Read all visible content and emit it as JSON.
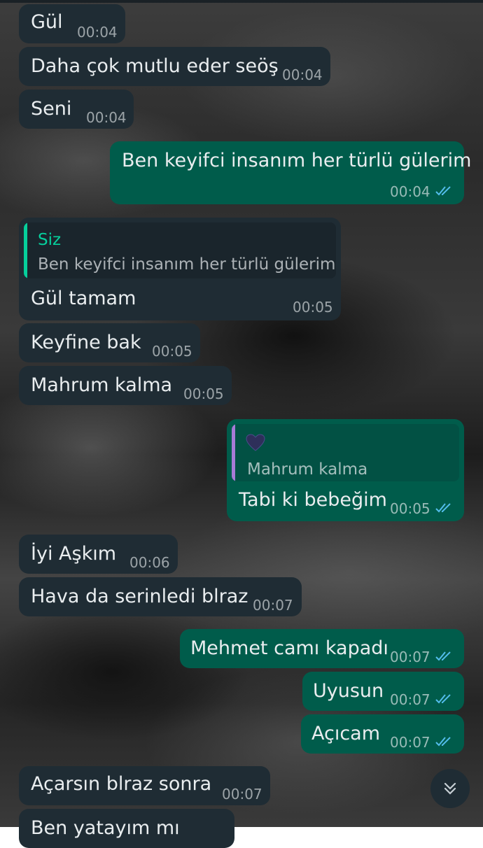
{
  "messages": [
    {
      "id": "m1",
      "dir": "in",
      "text": "Gül",
      "time": "00:04"
    },
    {
      "id": "m2",
      "dir": "in",
      "text": "Daha çok mutlu eder seöş",
      "time": "00:04"
    },
    {
      "id": "m3",
      "dir": "in",
      "text": "Seni",
      "time": "00:04"
    },
    {
      "id": "m4",
      "dir": "out",
      "text": "Ben keyifci insanım her türlü gülerim",
      "time": "00:04",
      "read": true
    },
    {
      "id": "m5",
      "dir": "in",
      "text": "Gül tamam",
      "time": "00:05",
      "quote": {
        "author": "Siz",
        "text": "Ben keyifci insanım her türlü gülerim"
      }
    },
    {
      "id": "m6",
      "dir": "in",
      "text": "Keyfine bak",
      "time": "00:05"
    },
    {
      "id": "m7",
      "dir": "in",
      "text": "Mahrum kalma",
      "time": "00:05"
    },
    {
      "id": "m8",
      "dir": "out",
      "text": "Tabi ki bebeğim",
      "time": "00:05",
      "read": true,
      "quote": {
        "author": "",
        "emoji": "heart-icon",
        "text": "Mahrum kalma"
      }
    },
    {
      "id": "m9",
      "dir": "in",
      "text": "İyi Aşkım",
      "time": "00:06"
    },
    {
      "id": "m10",
      "dir": "in",
      "text": "Hava da serinledi blraz",
      "time": "00:07"
    },
    {
      "id": "m11",
      "dir": "out",
      "text": "Mehmet camı kapadı",
      "time": "00:07",
      "read": true
    },
    {
      "id": "m12",
      "dir": "out",
      "text": "Uyusun",
      "time": "00:07",
      "read": true
    },
    {
      "id": "m13",
      "dir": "out",
      "text": "Açıcam",
      "time": "00:07",
      "read": true
    },
    {
      "id": "m14",
      "dir": "in",
      "text": "Açarsın blraz sonra",
      "time": "00:07"
    },
    {
      "id": "m15",
      "dir": "in",
      "text": "Ben yatayım mı",
      "time": ""
    }
  ],
  "colors": {
    "incoming": "#1f2c34",
    "outgoing": "#005c4b",
    "read_check": "#53bdeb",
    "quote_name": "#06cf9c",
    "quote_bar_in": "#06cf9c",
    "quote_bar_out": "#a77bd6"
  },
  "scroll_button": {
    "icon": "double-chevron-down-icon"
  }
}
